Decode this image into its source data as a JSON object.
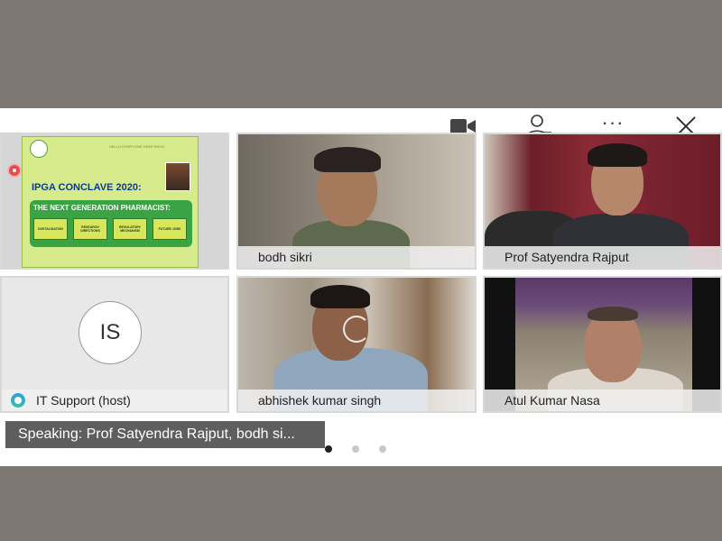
{
  "header": {
    "camera_icon": "camera-icon",
    "participants_icon": "participants-icon",
    "more_label": "···",
    "close_icon": "close-icon"
  },
  "slide": {
    "greeting": "HELLO EVERYONE GREETINGS",
    "title": "IPGA CONCLAVE 2020:",
    "subtitle": "THE NEXT GENERATION PHARMACIST:",
    "chips": [
      "DIGITALISATION",
      "RESEARCH DIRECTIONS",
      "REGULATORY MECHANISM",
      "FUTURE JOBS"
    ]
  },
  "participants": [
    {
      "name": "bodh sikri"
    },
    {
      "name": "Prof Satyendra Rajput"
    },
    {
      "name": "IT Support (host)",
      "initials": "IS"
    },
    {
      "name": "abhishek kumar singh"
    },
    {
      "name": "Atul Kumar Nasa"
    }
  ],
  "speaking": "Speaking: Prof Satyendra Rajput, bodh si...",
  "pagination": {
    "pages": 3,
    "current": 1
  },
  "colors": {
    "record": "#e24d4d",
    "accent_green": "#3aa343",
    "speaking_bg": "#5e5e5e"
  }
}
